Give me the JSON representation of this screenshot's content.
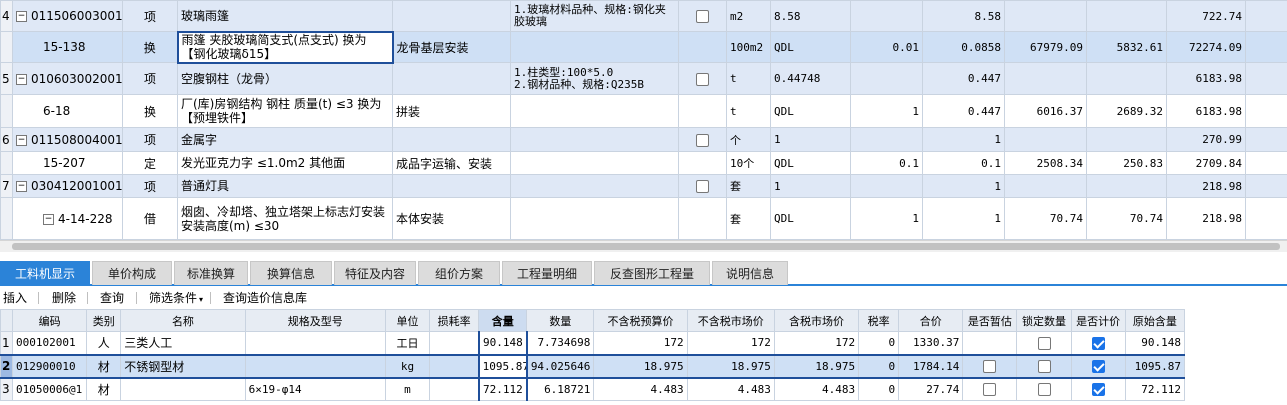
{
  "top_rows": [
    {
      "type": "qd",
      "idx": "4",
      "code": "011506003001",
      "cls": "项",
      "name": "玻璃雨篷",
      "content": "",
      "feature": "1.玻璃材料品种、规格:钢化夹胶玻璃",
      "unit": "m2",
      "expr": "8.58",
      "coef": "",
      "qty": "8.58",
      "price": "",
      "labor": "",
      "total": "722.74"
    },
    {
      "type": "sel",
      "idx": "",
      "code": "15-138",
      "cls": "换",
      "name": "雨篷 夹胶玻璃简支式(点支式)  换为【钢化玻璃δ15】",
      "content": "龙骨基层安装",
      "feature": "",
      "unit": "100m2",
      "expr": "QDL",
      "coef": "0.01",
      "qty": "0.0858",
      "price": "67979.09",
      "labor": "5832.61",
      "total": "72274.09"
    },
    {
      "type": "qd",
      "idx": "5",
      "code": "010603002001",
      "cls": "项",
      "name": "空腹钢柱（龙骨）",
      "content": "",
      "feature": "1.柱类型:100*5.0\n2.钢材品种、规格:Q235B",
      "unit": "t",
      "expr": "0.44748",
      "coef": "",
      "qty": "0.447",
      "price": "",
      "labor": "",
      "total": "6183.98"
    },
    {
      "type": "de",
      "idx": "",
      "code": "6-18",
      "cls": "换",
      "name": "厂(库)房钢结构 钢柱 质量(t) ≤3  换为【预埋铁件】",
      "content": "拼装",
      "feature": "",
      "unit": "t",
      "expr": "QDL",
      "coef": "1",
      "qty": "0.447",
      "price": "6016.37",
      "labor": "2689.32",
      "total": "6183.98"
    },
    {
      "type": "qd",
      "idx": "6",
      "code": "011508004001",
      "cls": "项",
      "name": "金属字",
      "content": "",
      "feature": "",
      "unit": "个",
      "expr": "1",
      "coef": "",
      "qty": "1",
      "price": "",
      "labor": "",
      "total": "270.99"
    },
    {
      "type": "de",
      "idx": "",
      "code": "15-207",
      "cls": "定",
      "name": "发光亚克力字 ≤1.0m2 其他面",
      "content": "成品字运输、安装",
      "feature": "",
      "unit": "10个",
      "expr": "QDL",
      "coef": "0.1",
      "qty": "0.1",
      "price": "2508.34",
      "labor": "250.83",
      "total": "2709.84"
    },
    {
      "type": "qd",
      "idx": "7",
      "code": "030412001001",
      "cls": "项",
      "name": "普通灯具",
      "content": "",
      "feature": "",
      "unit": "套",
      "expr": "1",
      "coef": "",
      "qty": "1",
      "price": "",
      "labor": "",
      "total": "218.98"
    },
    {
      "type": "de",
      "idx": "",
      "code": "4-14-228",
      "cls": "借",
      "name": "烟囱、冷却塔、独立塔架上标志灯安装 安装高度(m) ≤30",
      "content": "本体安装",
      "feature": "",
      "unit": "套",
      "expr": "QDL",
      "coef": "1",
      "qty": "1",
      "price": "70.74",
      "labor": "70.74",
      "total": "218.98"
    }
  ],
  "tabs": [
    "工料机显示",
    "单价构成",
    "标准换算",
    "换算信息",
    "特征及内容",
    "组价方案",
    "工程量明细",
    "反查图形工程量",
    "说明信息"
  ],
  "toolbar": {
    "insert": "插入",
    "delete": "删除",
    "query": "查询",
    "filter": "筛选条件",
    "price_lookup": "查询造价信息库"
  },
  "columns": [
    "编码",
    "类别",
    "名称",
    "规格及型号",
    "单位",
    "损耗率",
    "含量",
    "数量",
    "不含税预算价",
    "不含税市场价",
    "含税市场价",
    "税率",
    "合价",
    "是否暂估",
    "锁定数量",
    "是否计价",
    "原始含量"
  ],
  "rows": [
    {
      "idx": "1",
      "code": "000102001",
      "cat": "人",
      "name": "三类人工",
      "spec": "",
      "unit": "工日",
      "loss": "",
      "content": "90.148",
      "qty": "7.734698",
      "budget": "172",
      "market": "172",
      "market_tax": "172",
      "tax": "0",
      "total": "1330.37",
      "est": null,
      "lock": false,
      "priced": true,
      "orig": "90.148"
    },
    {
      "idx": "2",
      "code": "012900010",
      "cat": "材",
      "name": "不锈钢型材",
      "spec": "",
      "unit": "kg",
      "loss": "",
      "content": "1095.87",
      "qty": "94.025646",
      "budget": "18.975",
      "market": "18.975",
      "market_tax": "18.975",
      "tax": "0",
      "total": "1784.14",
      "est": false,
      "lock": false,
      "priced": true,
      "orig": "1095.87"
    },
    {
      "idx": "3",
      "code": "01050006@1",
      "cat": "材",
      "name": "",
      "spec": "6×19-φ14",
      "unit": "m",
      "loss": "",
      "content": "72.112",
      "qty": "6.18721",
      "budget": "4.483",
      "market": "4.483",
      "market_tax": "4.483",
      "tax": "0",
      "total": "27.74",
      "est": false,
      "lock": false,
      "priced": true,
      "orig": "72.112"
    }
  ]
}
